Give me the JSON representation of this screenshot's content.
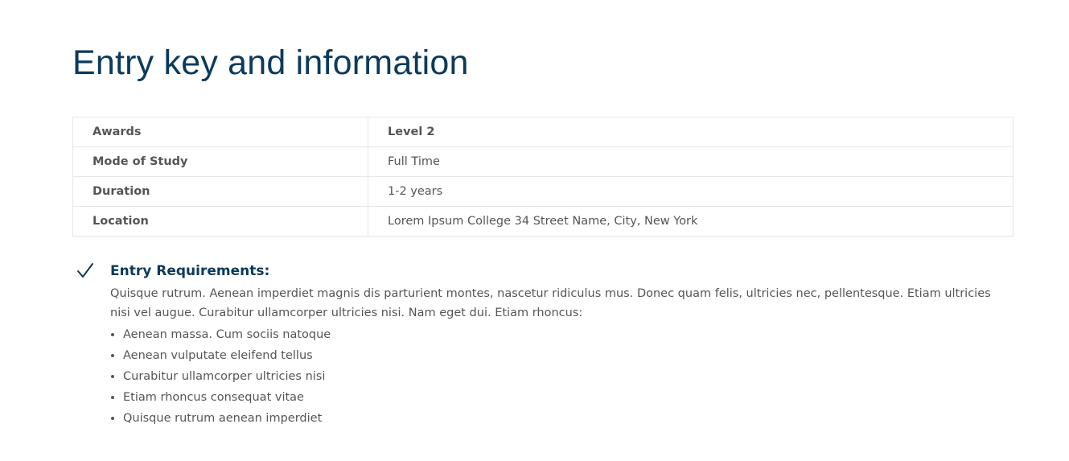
{
  "page": {
    "title": "Entry key and information"
  },
  "info_table": {
    "rows": [
      {
        "key": "Awards",
        "value": "Level 2"
      },
      {
        "key": "Mode of Study",
        "value": "Full Time"
      },
      {
        "key": "Duration",
        "value": "1-2 years"
      },
      {
        "key": "Location",
        "value": "Lorem Ipsum College 34 Street Name, City, New York"
      }
    ]
  },
  "entry_requirements": {
    "icon": "checkmark-icon",
    "title": "Entry Requirements:",
    "paragraph": "Quisque rutrum. Aenean imperdiet magnis dis parturient montes, nascetur ridiculus mus. Donec quam felis, ultricies nec, pellentesque. Etiam ultricies nisi vel augue. Curabitur ullamcorper ultricies nisi. Nam eget dui. Etiam rhoncus:",
    "items": [
      "Aenean massa. Cum sociis natoque",
      "Aenean vulputate eleifend tellus",
      "Curabitur ullamcorper ultricies nisi",
      "Etiam rhoncus consequat vitae",
      "Quisque rutrum aenean imperdiet"
    ]
  },
  "colors": {
    "heading": "#0b3a5c",
    "text": "#555555",
    "border": "#e6e6e6"
  }
}
